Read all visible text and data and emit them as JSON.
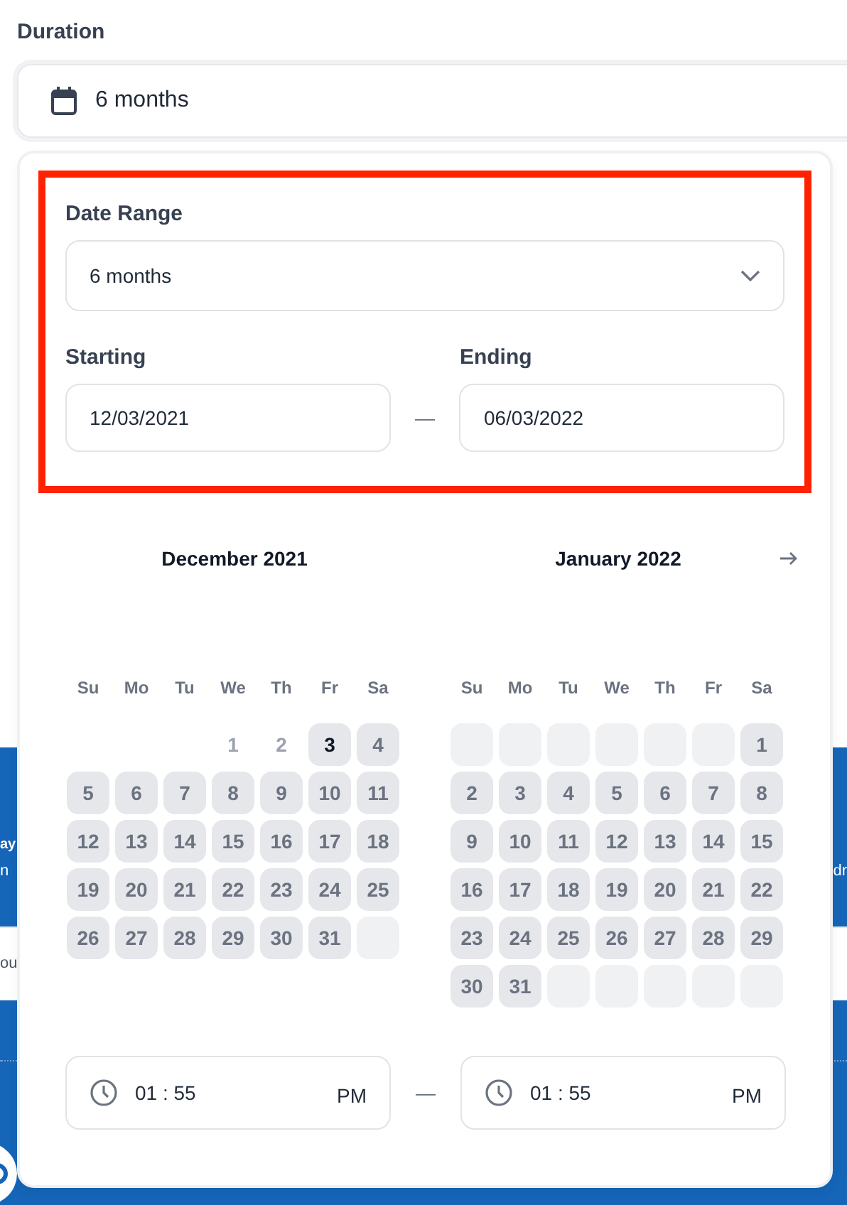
{
  "field": {
    "label": "Duration",
    "value": "6 months"
  },
  "banner": {
    "title_left": "ay",
    "subtitle_left": "n",
    "subtitle_right": "dr"
  },
  "strip": {
    "text_left": "ou"
  },
  "picker": {
    "range": {
      "label": "Date Range",
      "value": "6 months"
    },
    "start": {
      "label": "Starting",
      "value": "12/03/2021"
    },
    "end": {
      "label": "Ending",
      "value": "06/03/2022"
    },
    "separator": "—",
    "calendars": [
      {
        "title": "December 2021",
        "next_button": false,
        "weekdays": [
          "Su",
          "Mo",
          "Tu",
          "We",
          "Th",
          "Fr",
          "Sa"
        ],
        "days": [
          {
            "kind": "none"
          },
          {
            "kind": "none"
          },
          {
            "kind": "none"
          },
          {
            "kind": "day",
            "label": "1",
            "disabled": true,
            "selected": false
          },
          {
            "kind": "day",
            "label": "2",
            "disabled": true,
            "selected": false
          },
          {
            "kind": "day",
            "label": "3",
            "disabled": false,
            "selected": true
          },
          {
            "kind": "day",
            "label": "4",
            "disabled": false,
            "selected": false
          },
          {
            "kind": "day",
            "label": "5",
            "disabled": false,
            "selected": false
          },
          {
            "kind": "day",
            "label": "6",
            "disabled": false,
            "selected": false
          },
          {
            "kind": "day",
            "label": "7",
            "disabled": false,
            "selected": false
          },
          {
            "kind": "day",
            "label": "8",
            "disabled": false,
            "selected": false
          },
          {
            "kind": "day",
            "label": "9",
            "disabled": false,
            "selected": false
          },
          {
            "kind": "day",
            "label": "10",
            "disabled": false,
            "selected": false
          },
          {
            "kind": "day",
            "label": "11",
            "disabled": false,
            "selected": false
          },
          {
            "kind": "day",
            "label": "12",
            "disabled": false,
            "selected": false
          },
          {
            "kind": "day",
            "label": "13",
            "disabled": false,
            "selected": false
          },
          {
            "kind": "day",
            "label": "14",
            "disabled": false,
            "selected": false
          },
          {
            "kind": "day",
            "label": "15",
            "disabled": false,
            "selected": false
          },
          {
            "kind": "day",
            "label": "16",
            "disabled": false,
            "selected": false
          },
          {
            "kind": "day",
            "label": "17",
            "disabled": false,
            "selected": false
          },
          {
            "kind": "day",
            "label": "18",
            "disabled": false,
            "selected": false
          },
          {
            "kind": "day",
            "label": "19",
            "disabled": false,
            "selected": false
          },
          {
            "kind": "day",
            "label": "20",
            "disabled": false,
            "selected": false
          },
          {
            "kind": "day",
            "label": "21",
            "disabled": false,
            "selected": false
          },
          {
            "kind": "day",
            "label": "22",
            "disabled": false,
            "selected": false
          },
          {
            "kind": "day",
            "label": "23",
            "disabled": false,
            "selected": false
          },
          {
            "kind": "day",
            "label": "24",
            "disabled": false,
            "selected": false
          },
          {
            "kind": "day",
            "label": "25",
            "disabled": false,
            "selected": false
          },
          {
            "kind": "day",
            "label": "26",
            "disabled": false,
            "selected": false
          },
          {
            "kind": "day",
            "label": "27",
            "disabled": false,
            "selected": false
          },
          {
            "kind": "day",
            "label": "28",
            "disabled": false,
            "selected": false
          },
          {
            "kind": "day",
            "label": "29",
            "disabled": false,
            "selected": false
          },
          {
            "kind": "day",
            "label": "30",
            "disabled": false,
            "selected": false
          },
          {
            "kind": "day",
            "label": "31",
            "disabled": false,
            "selected": false
          },
          {
            "kind": "blank"
          }
        ]
      },
      {
        "title": "January 2022",
        "next_button": true,
        "weekdays": [
          "Su",
          "Mo",
          "Tu",
          "We",
          "Th",
          "Fr",
          "Sa"
        ],
        "days": [
          {
            "kind": "blank"
          },
          {
            "kind": "blank"
          },
          {
            "kind": "blank"
          },
          {
            "kind": "blank"
          },
          {
            "kind": "blank"
          },
          {
            "kind": "blank"
          },
          {
            "kind": "day",
            "label": "1",
            "disabled": false,
            "selected": false
          },
          {
            "kind": "day",
            "label": "2",
            "disabled": false,
            "selected": false
          },
          {
            "kind": "day",
            "label": "3",
            "disabled": false,
            "selected": false
          },
          {
            "kind": "day",
            "label": "4",
            "disabled": false,
            "selected": false
          },
          {
            "kind": "day",
            "label": "5",
            "disabled": false,
            "selected": false
          },
          {
            "kind": "day",
            "label": "6",
            "disabled": false,
            "selected": false
          },
          {
            "kind": "day",
            "label": "7",
            "disabled": false,
            "selected": false
          },
          {
            "kind": "day",
            "label": "8",
            "disabled": false,
            "selected": false
          },
          {
            "kind": "day",
            "label": "9",
            "disabled": false,
            "selected": false
          },
          {
            "kind": "day",
            "label": "10",
            "disabled": false,
            "selected": false
          },
          {
            "kind": "day",
            "label": "11",
            "disabled": false,
            "selected": false
          },
          {
            "kind": "day",
            "label": "12",
            "disabled": false,
            "selected": false
          },
          {
            "kind": "day",
            "label": "13",
            "disabled": false,
            "selected": false
          },
          {
            "kind": "day",
            "label": "14",
            "disabled": false,
            "selected": false
          },
          {
            "kind": "day",
            "label": "15",
            "disabled": false,
            "selected": false
          },
          {
            "kind": "day",
            "label": "16",
            "disabled": false,
            "selected": false
          },
          {
            "kind": "day",
            "label": "17",
            "disabled": false,
            "selected": false
          },
          {
            "kind": "day",
            "label": "18",
            "disabled": false,
            "selected": false
          },
          {
            "kind": "day",
            "label": "19",
            "disabled": false,
            "selected": false
          },
          {
            "kind": "day",
            "label": "20",
            "disabled": false,
            "selected": false
          },
          {
            "kind": "day",
            "label": "21",
            "disabled": false,
            "selected": false
          },
          {
            "kind": "day",
            "label": "22",
            "disabled": false,
            "selected": false
          },
          {
            "kind": "day",
            "label": "23",
            "disabled": false,
            "selected": false
          },
          {
            "kind": "day",
            "label": "24",
            "disabled": false,
            "selected": false
          },
          {
            "kind": "day",
            "label": "25",
            "disabled": false,
            "selected": false
          },
          {
            "kind": "day",
            "label": "26",
            "disabled": false,
            "selected": false
          },
          {
            "kind": "day",
            "label": "27",
            "disabled": false,
            "selected": false
          },
          {
            "kind": "day",
            "label": "28",
            "disabled": false,
            "selected": false
          },
          {
            "kind": "day",
            "label": "29",
            "disabled": false,
            "selected": false
          },
          {
            "kind": "day",
            "label": "30",
            "disabled": false,
            "selected": false
          },
          {
            "kind": "day",
            "label": "31",
            "disabled": false,
            "selected": false
          },
          {
            "kind": "blank"
          },
          {
            "kind": "blank"
          },
          {
            "kind": "blank"
          },
          {
            "kind": "blank"
          },
          {
            "kind": "blank"
          }
        ]
      }
    ],
    "times": [
      {
        "time": "01 : 55",
        "period": "PM"
      },
      {
        "time": "01 : 55",
        "period": "PM"
      }
    ]
  }
}
